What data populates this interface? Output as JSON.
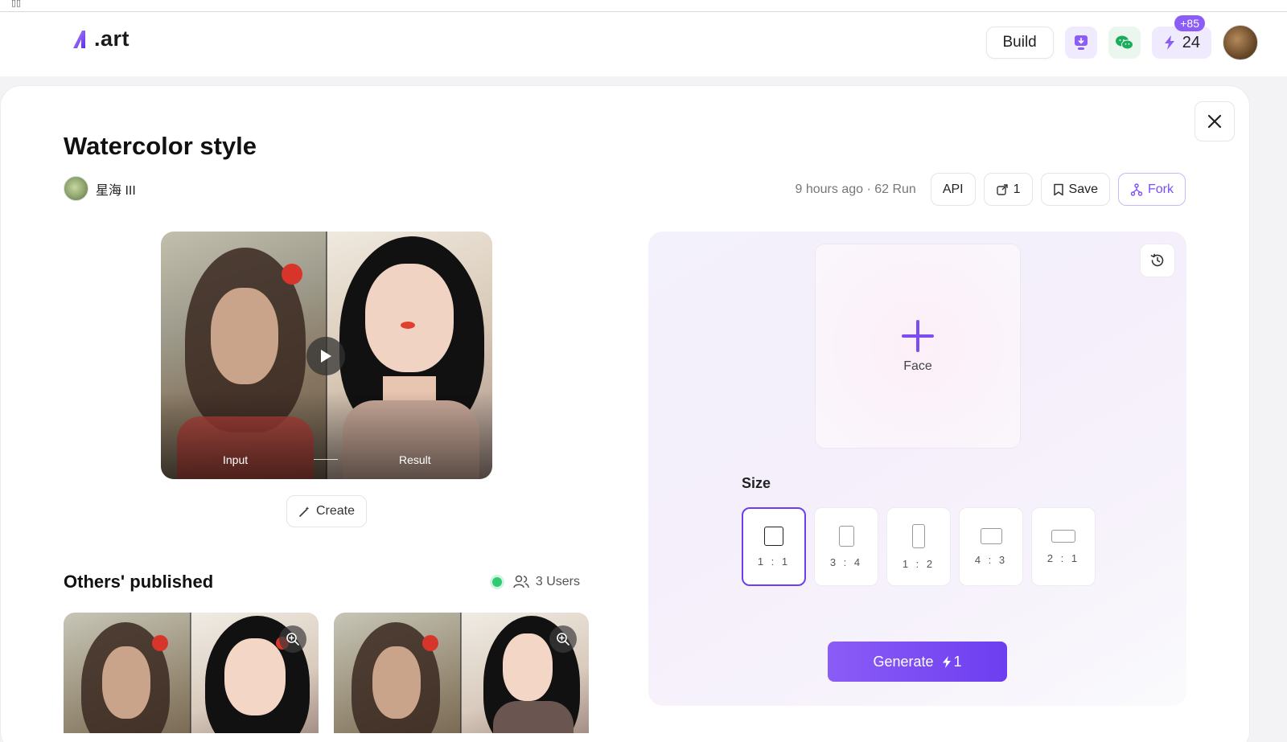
{
  "app": {
    "logo_text": ".art"
  },
  "nav": {
    "build_label": "Build",
    "credits": "24",
    "credits_bonus": "+85"
  },
  "page": {
    "title": "Watercolor style",
    "author_name": "星海 III",
    "meta": "9 hours ago · 62 Run",
    "actions": {
      "api_label": "API",
      "share_count": "1",
      "save_label": "Save",
      "fork_label": "Fork"
    }
  },
  "preview": {
    "input_label": "Input",
    "result_label": "Result",
    "create_label": "Create"
  },
  "others": {
    "title": "Others' published",
    "users_label": "3 Users"
  },
  "generator": {
    "upload_label": "Face",
    "size_label": "Size",
    "sizes": [
      {
        "ratio": "1 : 1",
        "selected": true
      },
      {
        "ratio": "3 : 4",
        "selected": false
      },
      {
        "ratio": "1 : 2",
        "selected": false
      },
      {
        "ratio": "4 : 3",
        "selected": false
      },
      {
        "ratio": "2 : 1",
        "selected": false
      }
    ],
    "generate_label": "Generate",
    "generate_cost": "1"
  },
  "colors": {
    "accent": "#6d3ef0",
    "accent_light": "#8b5cf6",
    "online": "#2ecc71"
  }
}
